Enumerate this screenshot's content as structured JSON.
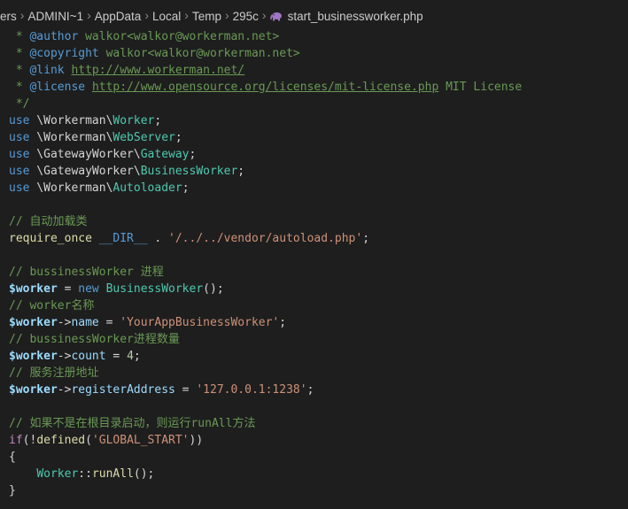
{
  "breadcrumb": {
    "parts": [
      "ers",
      "ADMINI~1",
      "AppData",
      "Local",
      "Temp",
      "295c"
    ],
    "separator": "›",
    "file_name": "start_businessworker.php",
    "file_icon": "php-elephant-icon"
  },
  "code": {
    "l1": {
      "star": " * ",
      "tag": "@author",
      "rest": " walkor<walkor@workerman.net>"
    },
    "l2": {
      "star": " * ",
      "tag": "@copyright",
      "rest": " walkor<walkor@workerman.net>"
    },
    "l3": {
      "star": " * ",
      "tag": "@link",
      "sp": " ",
      "url": "http://www.workerman.net/"
    },
    "l4": {
      "star": " * ",
      "tag": "@license",
      "sp": " ",
      "url": "http://www.opensource.org/licenses/mit-license.php",
      "rest": " MIT License"
    },
    "l5": {
      "text": " */"
    },
    "l6": {
      "kw": "use",
      "ns": " \\Workerman\\",
      "cls": "Worker",
      "end": ";"
    },
    "l7": {
      "kw": "use",
      "ns": " \\Workerman\\",
      "cls": "WebServer",
      "end": ";"
    },
    "l8": {
      "kw": "use",
      "ns": " \\GatewayWorker\\",
      "cls": "Gateway",
      "end": ";"
    },
    "l9": {
      "kw": "use",
      "ns": " \\GatewayWorker\\",
      "cls": "BusinessWorker",
      "end": ";"
    },
    "l10": {
      "kw": "use",
      "ns": " \\Workerman\\",
      "cls": "Autoloader",
      "end": ";"
    },
    "l12": {
      "text": "// 自动加载类"
    },
    "l13": {
      "fn": "require_once",
      "sp": " ",
      "const": "__DIR__",
      "op": " . ",
      "str": "'/../../vendor/autoload.php'",
      "end": ";"
    },
    "l15": {
      "text": "// bussinessWorker 进程"
    },
    "l16": {
      "var": "$worker",
      "op": " = ",
      "kw": "new",
      "sp": " ",
      "cls": "BusinessWorker",
      "end": "();"
    },
    "l17": {
      "text": "// worker名称"
    },
    "l18": {
      "var": "$worker",
      "arrow": "->",
      "prop": "name",
      "op": " = ",
      "str": "'YourAppBusinessWorker'",
      "end": ";"
    },
    "l19": {
      "text": "// bussinessWorker进程数量"
    },
    "l20": {
      "var": "$worker",
      "arrow": "->",
      "prop": "count",
      "op": " = ",
      "num": "4",
      "end": ";"
    },
    "l21": {
      "text": "// 服务注册地址"
    },
    "l22": {
      "var": "$worker",
      "arrow": "->",
      "prop": "registerAddress",
      "op": " = ",
      "str": "'127.0.0.1:1238'",
      "end": ";"
    },
    "l24": {
      "text": "// 如果不是在根目录启动，则运行runAll方法"
    },
    "l25": {
      "ctl": "if",
      "p1": "(!",
      "fn": "defined",
      "p2": "(",
      "str": "'GLOBAL_START'",
      "p3": "))"
    },
    "l26": {
      "text": "{"
    },
    "l27": {
      "indent": "    ",
      "cls": "Worker",
      "op": "::",
      "fn": "runAll",
      "end": "();"
    },
    "l28": {
      "text": "}"
    }
  },
  "colors": {
    "background": "#1e1e1e",
    "comment": "#6a9955",
    "keyword": "#569cd6",
    "class": "#4ec9b0",
    "function": "#dcdcaa",
    "string": "#ce9178",
    "variable": "#9cdcfe",
    "number": "#b5cea8",
    "control": "#c586c0",
    "php_icon": "#a074c4"
  }
}
